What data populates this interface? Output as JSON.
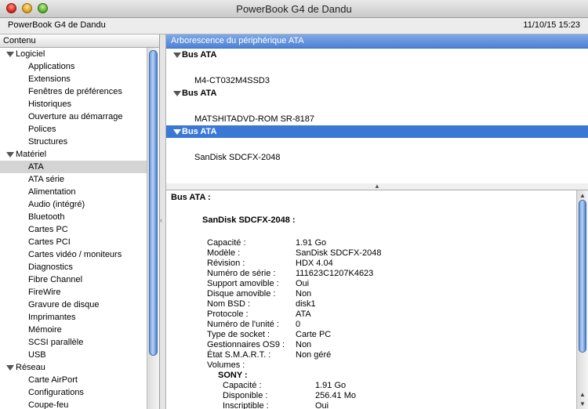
{
  "window": {
    "title": "PowerBook G4 de Dandu"
  },
  "infobar": {
    "machine": "PowerBook G4 de Dandu",
    "datetime": "11/10/15 15:23"
  },
  "sidebar": {
    "header": "Contenu",
    "items": [
      {
        "label": "Logiciel",
        "kind": "cat"
      },
      {
        "label": "Applications",
        "kind": "child"
      },
      {
        "label": "Extensions",
        "kind": "child"
      },
      {
        "label": "Fenêtres de préférences",
        "kind": "child"
      },
      {
        "label": "Historiques",
        "kind": "child"
      },
      {
        "label": "Ouverture au démarrage",
        "kind": "child"
      },
      {
        "label": "Polices",
        "kind": "child"
      },
      {
        "label": "Structures",
        "kind": "child"
      },
      {
        "label": "Matériel",
        "kind": "cat"
      },
      {
        "label": "ATA",
        "kind": "child",
        "selected": true
      },
      {
        "label": "ATA série",
        "kind": "child"
      },
      {
        "label": "Alimentation",
        "kind": "child"
      },
      {
        "label": "Audio (intégré)",
        "kind": "child"
      },
      {
        "label": "Bluetooth",
        "kind": "child"
      },
      {
        "label": "Cartes PC",
        "kind": "child"
      },
      {
        "label": "Cartes PCI",
        "kind": "child"
      },
      {
        "label": "Cartes vidéo / moniteurs",
        "kind": "child"
      },
      {
        "label": "Diagnostics",
        "kind": "child"
      },
      {
        "label": "Fibre Channel",
        "kind": "child"
      },
      {
        "label": "FireWire",
        "kind": "child"
      },
      {
        "label": "Gravure de disque",
        "kind": "child"
      },
      {
        "label": "Imprimantes",
        "kind": "child"
      },
      {
        "label": "Mémoire",
        "kind": "child"
      },
      {
        "label": "SCSI parallèle",
        "kind": "child"
      },
      {
        "label": "USB",
        "kind": "child"
      },
      {
        "label": "Réseau",
        "kind": "cat"
      },
      {
        "label": "Carte AirPort",
        "kind": "child"
      },
      {
        "label": "Configurations",
        "kind": "child"
      },
      {
        "label": "Coupe-feu",
        "kind": "child"
      }
    ]
  },
  "ata_tree": {
    "header": "Arborescence du périphérique ATA",
    "rows": [
      {
        "label": "Bus ATA",
        "kind": "bus"
      },
      {
        "label": "M4-CT032M4SSD3",
        "kind": "dev"
      },
      {
        "label": "Bus ATA",
        "kind": "bus"
      },
      {
        "label": "MATSHITADVD-ROM SR-8187",
        "kind": "dev"
      },
      {
        "label": "Bus ATA",
        "kind": "bus",
        "selected": true
      },
      {
        "label": "SanDisk SDCFX-2048",
        "kind": "dev"
      }
    ]
  },
  "detail": {
    "bus_title": "Bus ATA :",
    "device_title": "SanDisk SDCFX-2048 :",
    "props": [
      {
        "k": "Capacité :",
        "v": "1.91 Go"
      },
      {
        "k": "Modèle :",
        "v": "SanDisk SDCFX-2048"
      },
      {
        "k": "Révision :",
        "v": "HDX 4.04"
      },
      {
        "k": "Numéro de série :",
        "v": "111623C1207K4623"
      },
      {
        "k": "Support amovible :",
        "v": "Oui"
      },
      {
        "k": "Disque amovible :",
        "v": "Non"
      },
      {
        "k": "Nom BSD :",
        "v": "disk1"
      },
      {
        "k": "Protocole :",
        "v": "ATA"
      },
      {
        "k": "Numéro de l'unité :",
        "v": "0"
      },
      {
        "k": "Type de socket :",
        "v": "Carte PC"
      },
      {
        "k": "Gestionnaires OS9 :",
        "v": "Non"
      },
      {
        "k": "État S.M.A.R.T. :",
        "v": "Non géré"
      },
      {
        "k": "Volumes :",
        "v": ""
      }
    ],
    "volume_name": "SONY :",
    "volume_props": [
      {
        "k": "Capacité :",
        "v": "1.91 Go"
      },
      {
        "k": "Disponible :",
        "v": "256.41 Mo"
      },
      {
        "k": "Inscriptible :",
        "v": "Oui"
      }
    ]
  }
}
